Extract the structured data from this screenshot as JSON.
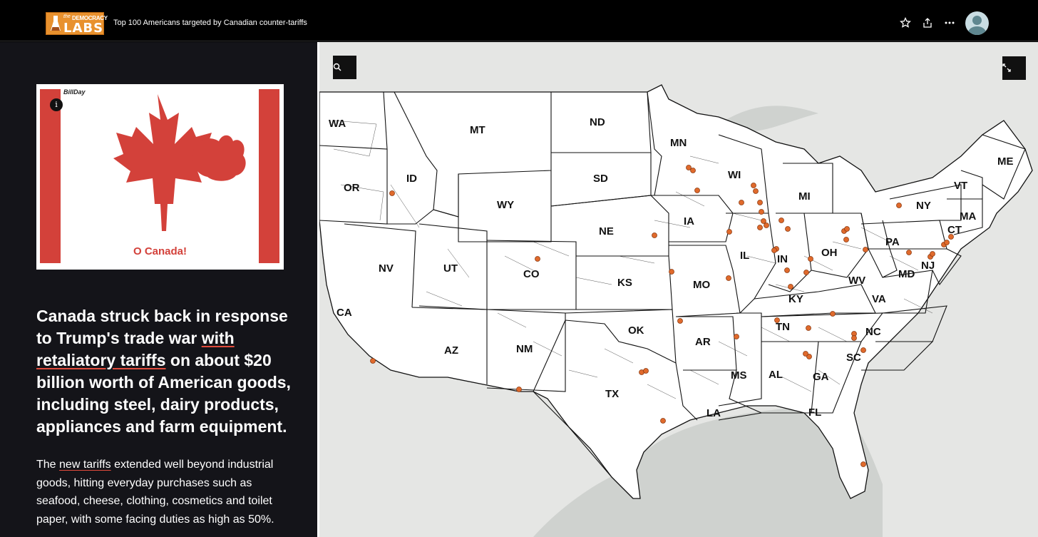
{
  "header": {
    "logo_the": "the",
    "logo_democracy": "DEMOCRACY",
    "logo_labs": "LABS",
    "title": "Top 100 Americans targeted by Canadian counter-tariffs",
    "icons": [
      "star-icon",
      "share-icon",
      "more-icon",
      "user-avatar"
    ]
  },
  "story": {
    "image_caption": "O Canada!",
    "image_signature": "BillDay",
    "info_icon": "i",
    "headline_part1": "Canada struck back in response to Trump's trade war ",
    "headline_link": "with retaliatory tariffs",
    "headline_part2": " on about $20 billion worth of American goods, including steel, dairy products, appliances and farm equipment.",
    "body_part1": "The ",
    "body_link": "new tariffs",
    "body_part2": " extended well beyond industrial goods, hitting everyday purchases such as seafood, cheese, clothing, cosmetics and toilet paper, with some facing duties as high as 50%."
  },
  "map": {
    "search_icon": "search-icon",
    "expand_icon": "expand-icon",
    "marker_color": "#e06a2c",
    "state_labels": [
      "WA",
      "OR",
      "CA",
      "ID",
      "NV",
      "MT",
      "WY",
      "UT",
      "AZ",
      "CO",
      "NM",
      "ND",
      "SD",
      "NE",
      "KS",
      "OK",
      "TX",
      "MN",
      "IA",
      "MO",
      "AR",
      "LA",
      "WI",
      "IL",
      "MS",
      "MI",
      "IN",
      "KY",
      "TN",
      "AL",
      "OH",
      "GA",
      "FL",
      "WV",
      "VA",
      "NC",
      "SC",
      "PA",
      "NY",
      "MD",
      "NJ",
      "CT",
      "VT",
      "MA",
      "ME"
    ]
  },
  "colors": {
    "accent_underline": "#e14b3c",
    "flag_red": "#d3413a",
    "logo_orange": "#e8912e"
  }
}
